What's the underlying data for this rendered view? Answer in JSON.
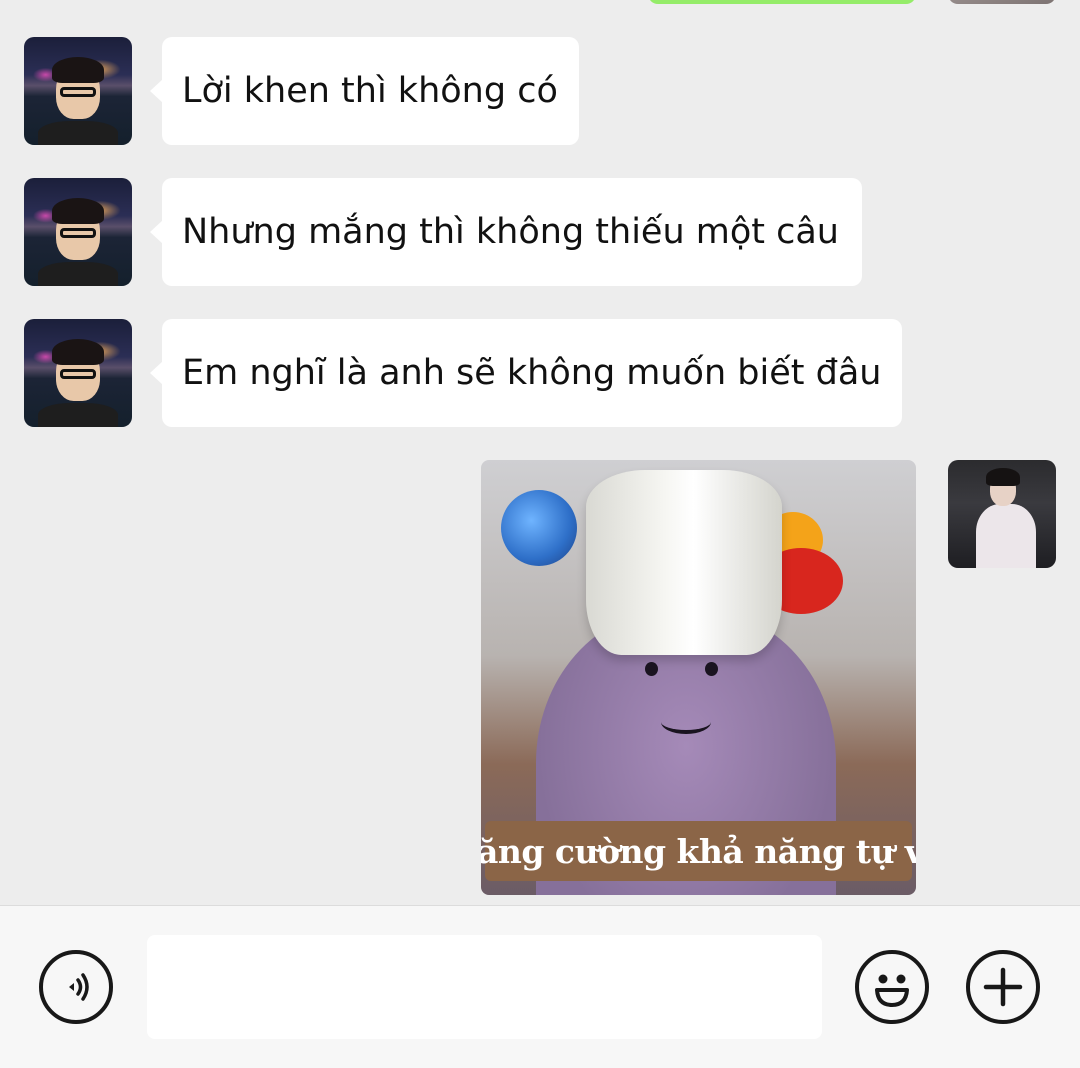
{
  "messages": [
    {
      "sender": "other",
      "text": "Lời khen thì không có"
    },
    {
      "sender": "other",
      "text": "Nhưng mắng thì không thiếu một câu"
    },
    {
      "sender": "other",
      "text": "Em nghĩ là anh sẽ không muốn biết đâu"
    },
    {
      "sender": "self",
      "type": "image",
      "caption": "Tăng cường khả năng tự vệ"
    }
  ],
  "input_bar": {
    "voice_icon": "voice-wave-icon",
    "text_value": "",
    "emoji_icon": "smiley-icon",
    "plus_icon": "plus-circle-icon"
  },
  "colors": {
    "background": "#ededed",
    "other_bubble": "#ffffff",
    "self_bubble": "#95ec69",
    "caption_bg": "#8b6547"
  }
}
